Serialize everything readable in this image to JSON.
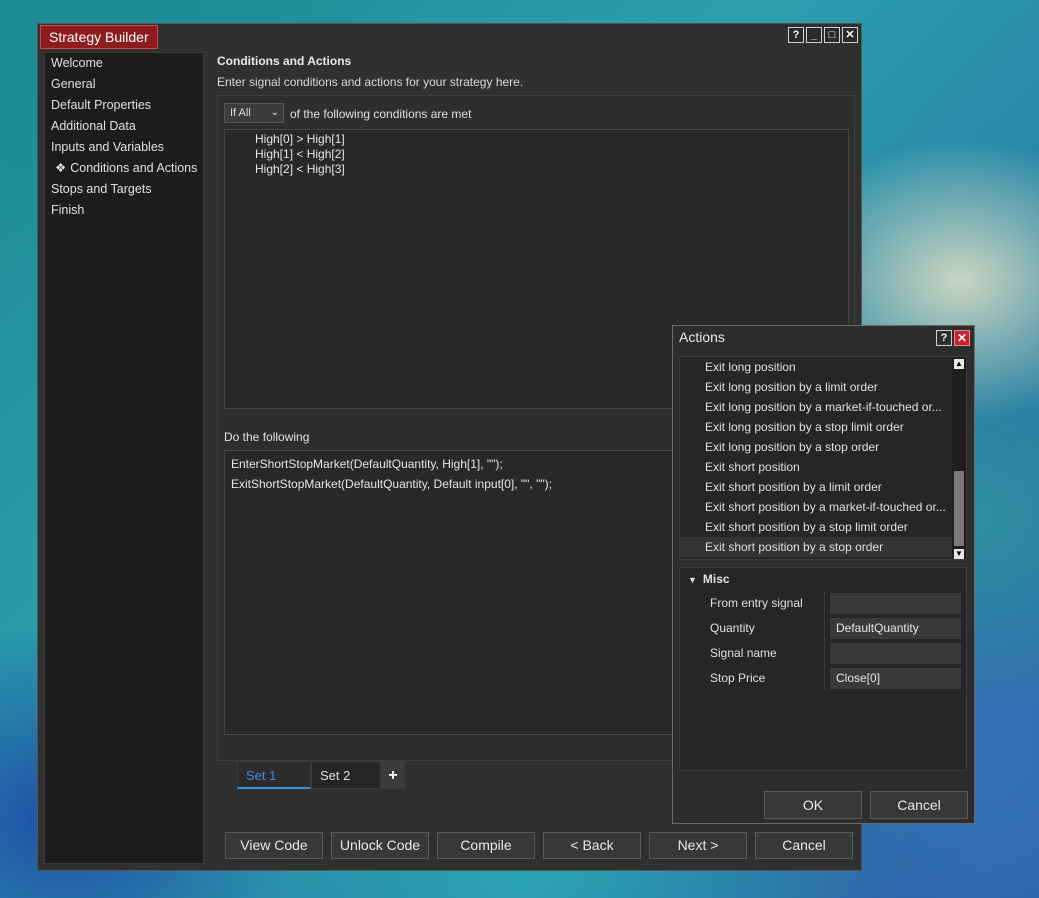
{
  "window": {
    "title": "Strategy Builder",
    "controls": {
      "help": "?",
      "minimize": "_",
      "maximize": "□",
      "close": "✕"
    }
  },
  "nav": {
    "items": [
      {
        "label": "Welcome"
      },
      {
        "label": "General"
      },
      {
        "label": "Default Properties"
      },
      {
        "label": "Additional Data"
      },
      {
        "label": "Inputs and Variables"
      },
      {
        "label": "Conditions and Actions",
        "active": true,
        "bullet": "❖"
      },
      {
        "label": "Stops and Targets"
      },
      {
        "label": "Finish"
      }
    ]
  },
  "main": {
    "title": "Conditions and Actions",
    "description": "Enter signal conditions and actions for your strategy here.",
    "if_select": {
      "value": "If All",
      "chevron": "⌄"
    },
    "conditions_label": "of the following conditions are met",
    "conditions": [
      "High[0] > High[1]",
      "High[1] < High[2]",
      "High[2] < High[3]"
    ],
    "do_label": "Do the following",
    "actions": [
      "EnterShortStopMarket(DefaultQuantity, High[1], \"\");",
      "ExitShortStopMarket(DefaultQuantity, Default input[0], \"\", \"\");"
    ],
    "sets": [
      {
        "label": "Set 1",
        "selected": true
      },
      {
        "label": "Set 2"
      }
    ],
    "add_set": "+"
  },
  "buttons": {
    "view_code": "View Code",
    "unlock_code": "Unlock Code",
    "compile": "Compile",
    "back": "< Back",
    "next": "Next >",
    "cancel": "Cancel"
  },
  "actions_dialog": {
    "title": "Actions",
    "help": "?",
    "close": "✕",
    "items": [
      {
        "label": "Exit long position"
      },
      {
        "label": "Exit long position by a limit order"
      },
      {
        "label": "Exit long position by a market-if-touched or..."
      },
      {
        "label": "Exit long position by a stop limit order"
      },
      {
        "label": "Exit long position by a stop order"
      },
      {
        "label": "Exit short position"
      },
      {
        "label": "Exit short position by a limit order"
      },
      {
        "label": "Exit short position by a market-if-touched or..."
      },
      {
        "label": "Exit short position by a stop limit order"
      },
      {
        "label": "Exit short position by a stop order",
        "selected": true
      }
    ],
    "scroll_up": "▲",
    "scroll_down": "▼",
    "misc": {
      "header": "Misc",
      "toggle": "▼",
      "properties": [
        {
          "label": "From entry signal",
          "value": ""
        },
        {
          "label": "Quantity",
          "value": "DefaultQuantity"
        },
        {
          "label": "Signal name",
          "value": ""
        },
        {
          "label": "Stop Price",
          "value": "Close[0]"
        }
      ]
    },
    "ok": "OK",
    "cancel": "Cancel"
  },
  "colors": {
    "title_accent": "#8e1b1f",
    "selected_tab": "#3b8fe0",
    "close_button": "#c8232a"
  }
}
